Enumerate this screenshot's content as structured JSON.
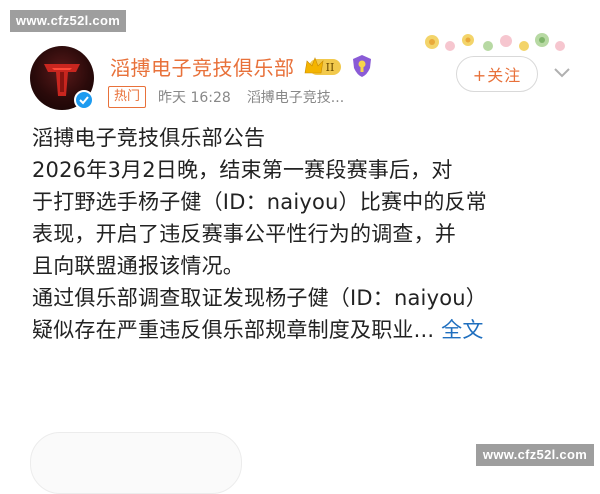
{
  "watermark": {
    "text": "www.cfz52l.com"
  },
  "post": {
    "account_name": "滔搏电子竞技俱乐部",
    "level_badge": "II",
    "hot_tag": "热门",
    "time": "昨天 16:28",
    "source": "滔搏电子竞技...",
    "follow_label": "+关注",
    "content": {
      "title": "滔搏电子竞技俱乐部公告",
      "line1": "2026年3月2日晚，结束第一赛段赛事后，对",
      "line2": "于打野选手杨子健（ID：naiyou）比赛中的反常",
      "line3": "表现，开启了违反赛事公平性行为的调查，并",
      "line4": "且向联盟通报该情况。",
      "line5": "通过俱乐部调查取证发现杨子健（ID：naiyou）",
      "line6": "疑似存在严重违反俱乐部规章制度及职业...",
      "more_label": "全文"
    }
  },
  "colors": {
    "accent": "#e8713a",
    "link": "#1f6fbf",
    "verify": "#1d9bf0",
    "watermark_bg": "#969696"
  },
  "icons": {
    "verify": "verified-check-icon",
    "crown": "crown-level-badge-icon",
    "shield": "shield-badge-icon",
    "chevron": "chevron-down-icon"
  }
}
